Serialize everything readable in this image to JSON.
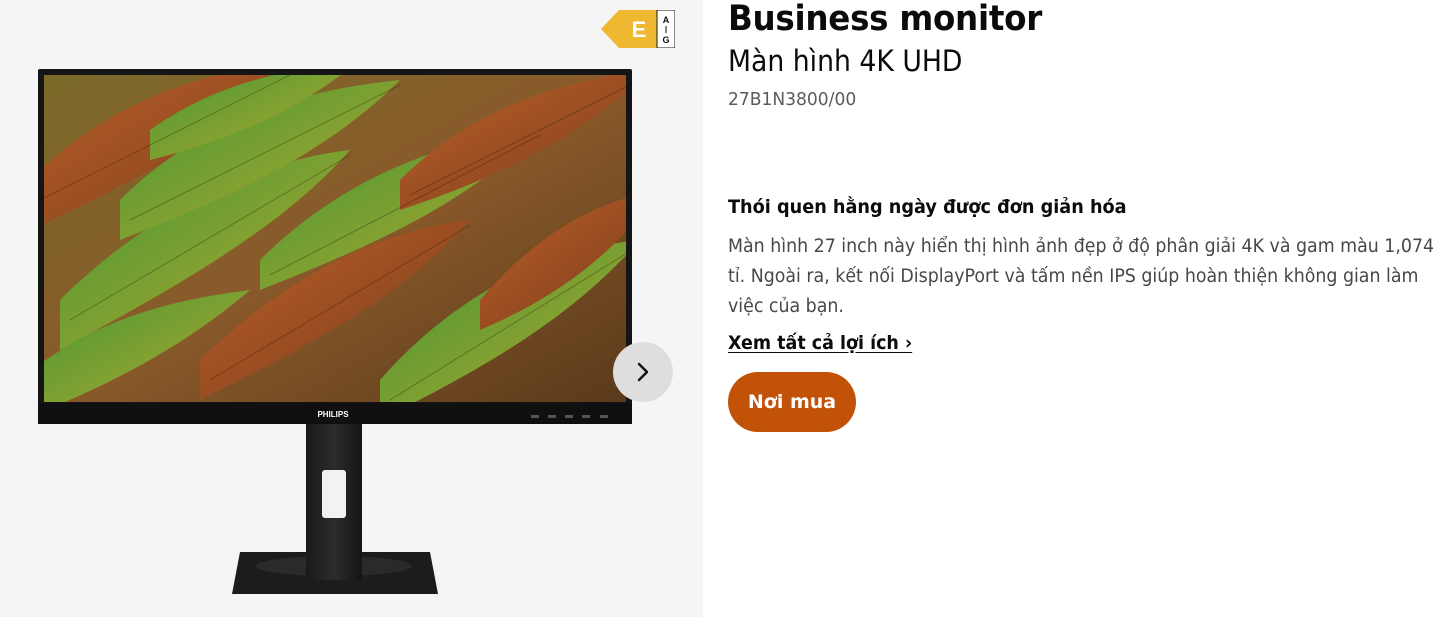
{
  "energy_label": {
    "class": "E",
    "scale_top": "A",
    "scale_bottom": "G",
    "color": "#f0b731"
  },
  "gallery": {
    "next_icon": "chevron-right-icon",
    "brand": "PHILIPS"
  },
  "product": {
    "title": "Business monitor",
    "subtitle": "Màn hình 4K UHD",
    "ctn": "27B1N3800/00"
  },
  "benefit": {
    "heading": "Thói quen hằng ngày được đơn giản hóa",
    "text": "Màn hình 27 inch này hiển thị hình ảnh đẹp ở độ phân giải 4K và gam màu 1,074 tỉ. Ngoài ra, kết nối DisplayPort và tấm nền IPS giúp hoàn thiện không gian làm việc của bạn.",
    "link": "Xem tất cả lợi ích ›"
  },
  "cta": {
    "buy_label": "Nơi mua",
    "color": "#c25208"
  }
}
